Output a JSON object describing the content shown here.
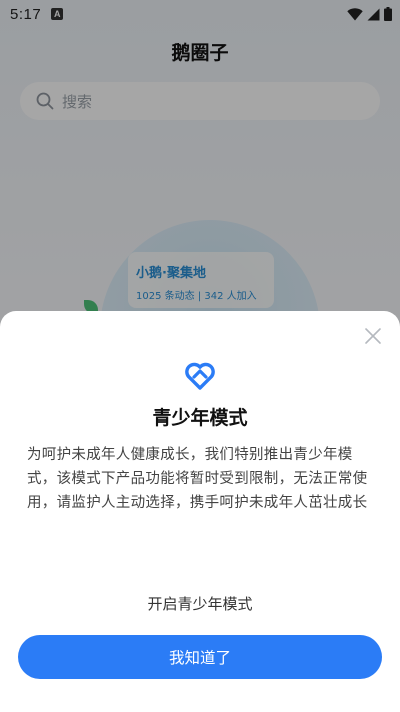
{
  "status_bar": {
    "time": "5:17",
    "notification_badge": "A"
  },
  "app": {
    "title": "鹅圈子",
    "search": {
      "placeholder": "搜索"
    },
    "featured_card": {
      "title": "小鹅·聚集地",
      "subtitle": "1025 条动态 | 342 人加入"
    }
  },
  "dialog": {
    "title": "青少年模式",
    "description": "为呵护未成年人健康成长，我们特别推出青少年模式，该模式下产品功能将暂时受到限制，无法正常使用，请监护人主动选择，携手呵护未成年人茁壮成长",
    "enable_label": "开启青少年模式",
    "confirm_label": "我知道了",
    "accent_color": "#2b7cf6"
  }
}
